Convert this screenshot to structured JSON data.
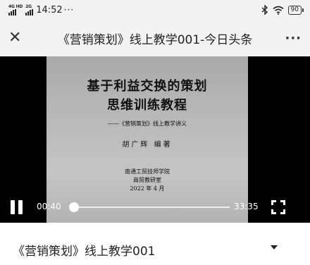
{
  "status_bar": {
    "signal_1_label": "4G HD",
    "signal_2_label": "2G",
    "time": "14:52",
    "more": "···",
    "battery": "90",
    "icons": [
      "signal-icon",
      "bluetooth-icon",
      "wifi-icon",
      "battery-icon"
    ]
  },
  "title_bar": {
    "title": "《营销策划》线上教学001-今日头条",
    "close_icon": "close-icon",
    "more_label": "···"
  },
  "video": {
    "slide": {
      "title": "基于利益交换的策划",
      "subtitle": "思维训练教程",
      "tag": "——《营销策划》线上教学讲义",
      "author": "胡广辉 编著",
      "school": "南通工贸技师学院",
      "department": "商贸教研室",
      "date": "2022 年 4 月"
    },
    "current_time": "00:40",
    "total_time": "33:35",
    "progress_fraction": 0.02,
    "state": "playing"
  },
  "info": {
    "video_title": "《营销策划》线上教学001"
  }
}
